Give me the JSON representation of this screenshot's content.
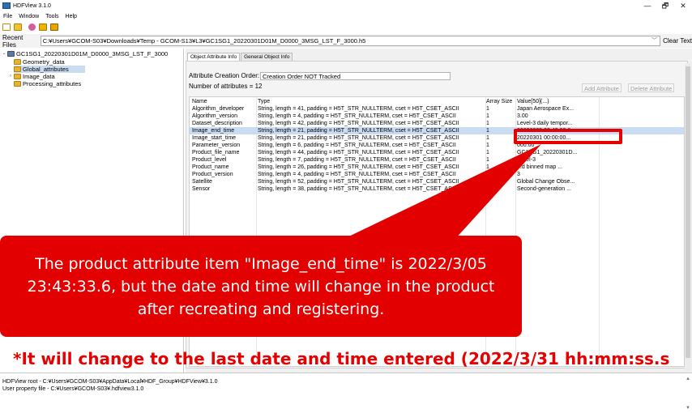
{
  "window": {
    "title": "HDFView 3.1.0",
    "min": "—",
    "restore": "🗗",
    "close": "✕"
  },
  "menu": [
    "File",
    "Window",
    "Tools",
    "Help"
  ],
  "toolbar": {
    "icons": [
      "new-file-icon",
      "open-folder-icon",
      "help-icon",
      "users-icon",
      "users-group-icon"
    ]
  },
  "recent": {
    "label": "Recent Files",
    "path": "C:¥Users¥GCOM-S03¥Downloads¥Temp - GCOM-S13¥L3¥GC1SG1_20220301D01M_D0000_3MSG_LST_F_3000.h5",
    "clear_label": "Clear Text"
  },
  "tree": {
    "root": "GC1SG1_20220301D01M_D0000_3MSG_LST_F_3000",
    "items": [
      "Geometry_data",
      "Global_attributes",
      "Image_data",
      "Processing_attributes"
    ]
  },
  "tabs": {
    "object_attr": "Object Attribute Info",
    "general": "General Object Info"
  },
  "attrs": {
    "creation_order_label": "Attribute Creation Order:",
    "creation_order_value": "Creation Order NOT Tracked",
    "count_label": "Number of attributes = 12",
    "add_button": "Add Attribute",
    "delete_button": "Delete Attribute"
  },
  "table": {
    "headers": [
      "Name",
      "Type",
      "Array Size",
      "Value[50](...)"
    ],
    "rows": [
      [
        "Algorithm_developer",
        "String, length = 41, padding = H5T_STR_NULLTERM, cset = H5T_CSET_ASCII",
        "1",
        "Japan Aerospace Ex..."
      ],
      [
        "Algorithm_version",
        "String, length = 4, padding = H5T_STR_NULLTERM, cset = H5T_CSET_ASCII",
        "1",
        "3.00"
      ],
      [
        "Dataset_description",
        "String, length = 42, padding = H5T_STR_NULLTERM, cset = H5T_CSET_ASCII",
        "1",
        "Level-3 daily tempor..."
      ],
      [
        "Image_end_time",
        "String, length = 21, padding = H5T_STR_NULLTERM, cset = H5T_CSET_ASCII",
        "1",
        "20220305 23:43:33.6..."
      ],
      [
        "Image_start_time",
        "String, length = 21, padding = H5T_STR_NULLTERM, cset = H5T_CSET_ASCII",
        "1",
        "20220301 00:00:00..."
      ],
      [
        "Parameter_version",
        "String, length = 6, padding = H5T_STR_NULLTERM, cset = H5T_CSET_ASCII",
        "1",
        "000.00"
      ],
      [
        "Product_file_name",
        "String, length = 44, padding = H5T_STR_NULLTERM, cset = H5T_CSET_ASCII",
        "1",
        "GC1SG1_20220301D..."
      ],
      [
        "Product_level",
        "String, length = 7, padding = H5T_STR_NULLTERM, cset = H5T_CSET_ASCII",
        "1",
        "Level-3"
      ],
      [
        "Product_name",
        "String, length = 26, padding = H5T_STR_NULLTERM, cset = H5T_CSET_ASCII",
        "1",
        "...d binned map ..."
      ],
      [
        "Product_version",
        "String, length = 4, padding = H5T_STR_NULLTERM, cset = H5T_CSET_ASCII",
        "1",
        "3"
      ],
      [
        "Satellite",
        "String, length = 52, padding = H5T_STR_NULLTERM, cset = H5T_CSET_ASCII",
        "1",
        "Global Change Obse..."
      ],
      [
        "Sensor",
        "String, length = 38, padding = H5T_STR_NULLTERM, cset = H5T_CSET_ASCII",
        "1",
        "Second-generation ..."
      ]
    ]
  },
  "callout": {
    "line1": "The product attribute item \"Image_end_time\" is 2022/3/05",
    "line2": "23:43:33.6, but the date and time will change in the product",
    "line3": "after recreating and registering.",
    "note": "*It will change to the last date and time entered (2022/3/31 hh:mm:ss.s"
  },
  "status": {
    "line1": "HDFView root - C:¥Users¥GCOM-S03¥AppData¥Local¥HDF_Group¥HDFView¥3.1.0",
    "line2": "User property file - C:¥Users¥GCOM-S03¥.hdfview3.1.0"
  },
  "colors": {
    "accent_red": "#e30000",
    "selection": "#c9dcf2"
  }
}
